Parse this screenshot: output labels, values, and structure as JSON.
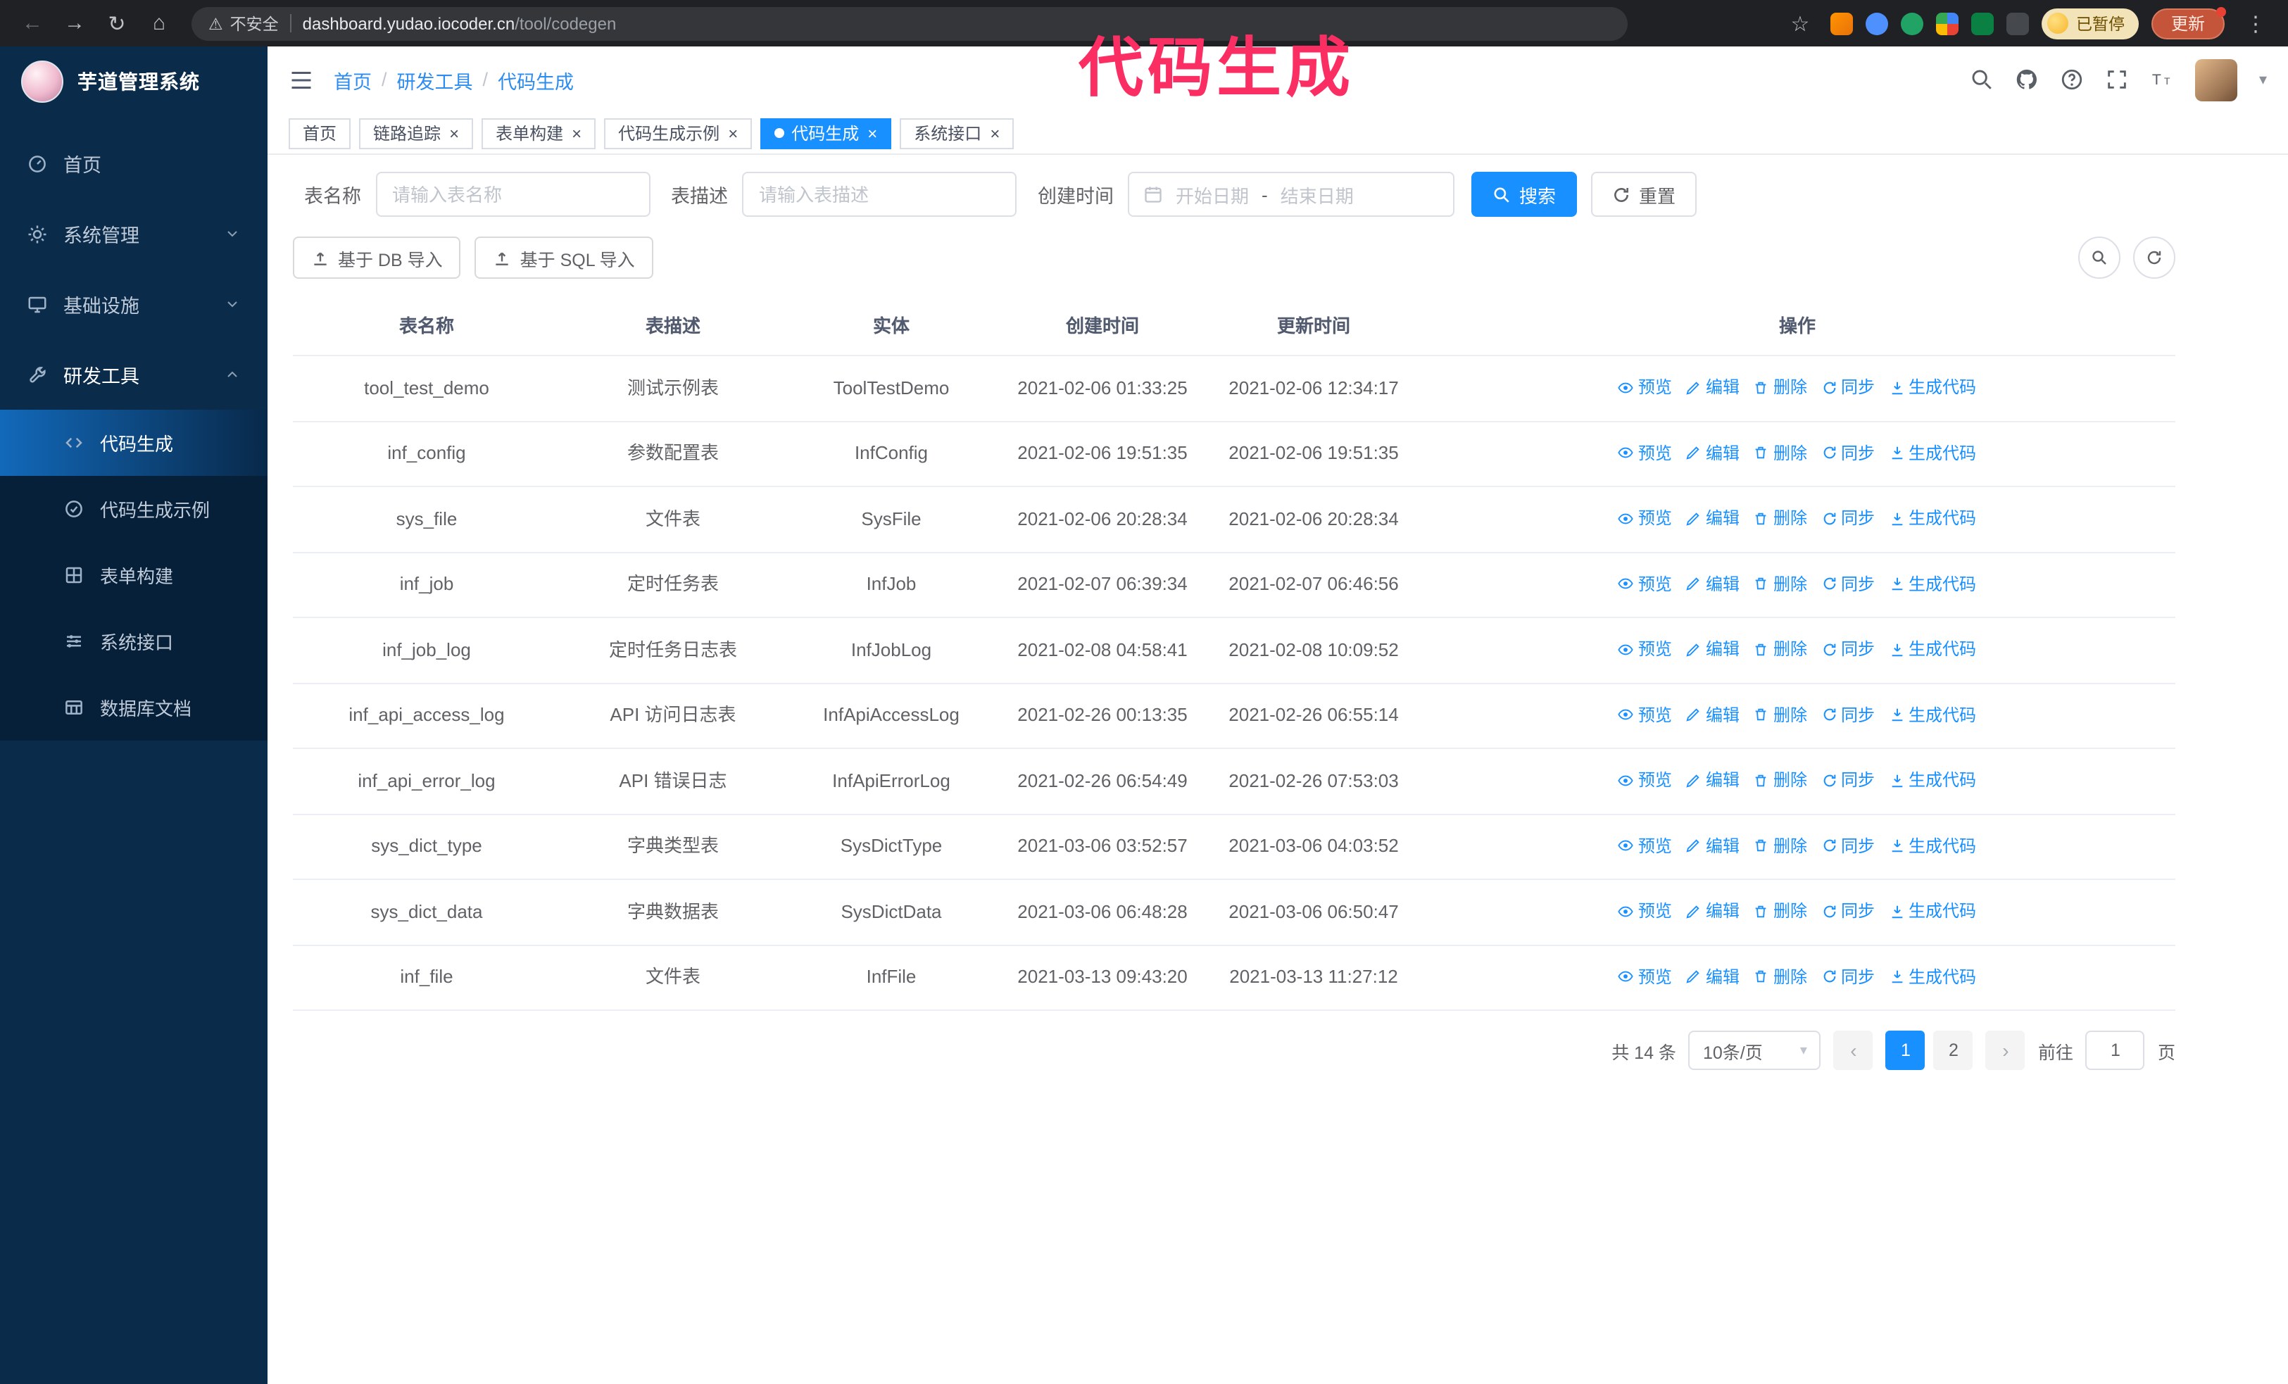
{
  "browser": {
    "security_label": "不安全",
    "url_host": "dashboard.yudao.iocoder.cn",
    "url_path": "/tool/codegen",
    "paused_badge": "已暂停",
    "update_button": "更新"
  },
  "annotation": {
    "text": "代码生成"
  },
  "sidebar": {
    "logo_title": "芋道管理系统",
    "items": [
      {
        "label": "首页"
      },
      {
        "label": "系统管理"
      },
      {
        "label": "基础设施"
      },
      {
        "label": "研发工具"
      }
    ],
    "subitems": [
      {
        "label": "代码生成"
      },
      {
        "label": "代码生成示例"
      },
      {
        "label": "表单构建"
      },
      {
        "label": "系统接口"
      },
      {
        "label": "数据库文档"
      }
    ]
  },
  "breadcrumb": {
    "items": [
      "首页",
      "研发工具",
      "代码生成"
    ],
    "separator": "/"
  },
  "tabs": [
    {
      "label": "首页",
      "closable": false,
      "active": false
    },
    {
      "label": "链路追踪",
      "closable": true,
      "active": false
    },
    {
      "label": "表单构建",
      "closable": true,
      "active": false
    },
    {
      "label": "代码生成示例",
      "closable": true,
      "active": false
    },
    {
      "label": "代码生成",
      "closable": true,
      "active": true
    },
    {
      "label": "系统接口",
      "closable": true,
      "active": false
    }
  ],
  "filters": {
    "table_name_label": "表名称",
    "table_name_placeholder": "请输入表名称",
    "table_desc_label": "表描述",
    "table_desc_placeholder": "请输入表描述",
    "create_time_label": "创建时间",
    "start_date_placeholder": "开始日期",
    "range_separator": "-",
    "end_date_placeholder": "结束日期",
    "search_button": "搜索",
    "reset_button": "重置"
  },
  "toolbar": {
    "import_db_button": "基于 DB 导入",
    "import_sql_button": "基于 SQL 导入"
  },
  "table": {
    "columns": [
      "表名称",
      "表描述",
      "实体",
      "创建时间",
      "更新时间",
      "操作"
    ],
    "actions": [
      {
        "label": "预览",
        "name": "preview",
        "icon": "eye-icon"
      },
      {
        "label": "编辑",
        "name": "edit",
        "icon": "edit-icon"
      },
      {
        "label": "删除",
        "name": "delete",
        "icon": "delete-icon"
      },
      {
        "label": "同步",
        "name": "sync",
        "icon": "sync-icon"
      },
      {
        "label": "生成代码",
        "name": "generate-code",
        "icon": "download-icon"
      }
    ],
    "rows": [
      {
        "name": "tool_test_demo",
        "desc": "测试示例表",
        "entity": "ToolTestDemo",
        "create_time": "2021-02-06 01:33:25",
        "update_time": "2021-02-06 12:34:17"
      },
      {
        "name": "inf_config",
        "desc": "参数配置表",
        "entity": "InfConfig",
        "create_time": "2021-02-06 19:51:35",
        "update_time": "2021-02-06 19:51:35"
      },
      {
        "name": "sys_file",
        "desc": "文件表",
        "entity": "SysFile",
        "create_time": "2021-02-06 20:28:34",
        "update_time": "2021-02-06 20:28:34"
      },
      {
        "name": "inf_job",
        "desc": "定时任务表",
        "entity": "InfJob",
        "create_time": "2021-02-07 06:39:34",
        "update_time": "2021-02-07 06:46:56"
      },
      {
        "name": "inf_job_log",
        "desc": "定时任务日志表",
        "entity": "InfJobLog",
        "create_time": "2021-02-08 04:58:41",
        "update_time": "2021-02-08 10:09:52"
      },
      {
        "name": "inf_api_access_log",
        "desc": "API 访问日志表",
        "entity": "InfApiAccessLog",
        "create_time": "2021-02-26 00:13:35",
        "update_time": "2021-02-26 06:55:14"
      },
      {
        "name": "inf_api_error_log",
        "desc": "API 错误日志",
        "entity": "InfApiErrorLog",
        "create_time": "2021-02-26 06:54:49",
        "update_time": "2021-02-26 07:53:03"
      },
      {
        "name": "sys_dict_type",
        "desc": "字典类型表",
        "entity": "SysDictType",
        "create_time": "2021-03-06 03:52:57",
        "update_time": "2021-03-06 04:03:52"
      },
      {
        "name": "sys_dict_data",
        "desc": "字典数据表",
        "entity": "SysDictData",
        "create_time": "2021-03-06 06:48:28",
        "update_time": "2021-03-06 06:50:47"
      },
      {
        "name": "inf_file",
        "desc": "文件表",
        "entity": "InfFile",
        "create_time": "2021-03-13 09:43:20",
        "update_time": "2021-03-13 11:27:12"
      }
    ]
  },
  "pagination": {
    "total_text": "共 14 条",
    "page_size_text": "10条/页",
    "pages": [
      "1",
      "2"
    ],
    "active_page": "1",
    "prev_glyph": "‹",
    "next_glyph": "›",
    "goto_label": "前往",
    "goto_value": "1",
    "goto_suffix": "页"
  },
  "colors": {
    "accent": "#1890ff",
    "sidebar_bg": "#0b2b4a",
    "annotation": "#fb2e63"
  }
}
